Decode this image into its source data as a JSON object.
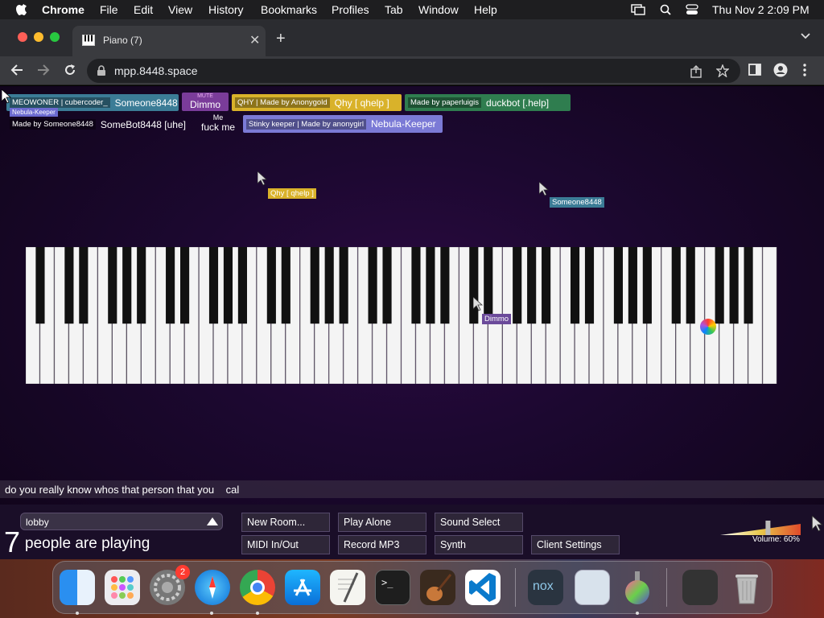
{
  "menubar": {
    "app": "Chrome",
    "items": [
      "File",
      "Edit",
      "View",
      "History",
      "Bookmarks",
      "Profiles",
      "Tab",
      "Window",
      "Help"
    ],
    "clock": "Thu Nov 2  2:09 PM"
  },
  "browser": {
    "tab_title": "Piano (7)",
    "url": "mpp.8448.space"
  },
  "participants": [
    {
      "sub": "MEOWONER | cubercoder_",
      "name": "Someone8448",
      "extra": "Nebula-Keeper",
      "color": "#3b7c96"
    },
    {
      "sub": "MUTE",
      "name": "Dimmo",
      "color": "#7a3c9a"
    },
    {
      "sub": "QHY | Made by Anonygold",
      "name": "Qhy [ qhelp ]",
      "color": "#d9b22a"
    },
    {
      "sub": "Made by paperluigis",
      "name": "duckbot [.help]",
      "color": "#2f7d4f"
    },
    {
      "sub": "Made by Someone8448",
      "name": "SomeBot8448 [uhe]",
      "color": "transparent"
    },
    {
      "sub": "Me",
      "name": "fuck me",
      "color": "transparent"
    },
    {
      "sub": "Stinky keeper | Made by anonygirl",
      "name": "Nebula-Keeper",
      "color": "#7b7ad6"
    }
  ],
  "cursors": [
    {
      "label": "Qhy [ qhelp ]",
      "color": "#d9b22a"
    },
    {
      "label": "Someone8448",
      "color": "#3b7c96"
    },
    {
      "label": "Dimmo",
      "color": "#6b4a9a"
    }
  ],
  "chat_input": "do you really know whos that person that you    cal",
  "controls": {
    "room": "lobby",
    "player_count": "7",
    "player_label": "people are playing",
    "buttons": [
      "New Room...",
      "Play Alone",
      "Sound Select",
      "MIDI In/Out",
      "Record MP3",
      "Synth",
      "Client Settings"
    ],
    "volume_label": "Volume: 60%",
    "volume_value": 0.6
  },
  "dock": {
    "settings_badge": "2",
    "apps": [
      "finder-icon",
      "launchpad-icon",
      "system-settings-icon",
      "safari-icon",
      "chrome-icon",
      "app-store-icon",
      "textedit-icon",
      "terminal-icon",
      "garageband-icon",
      "vscode-icon",
      "nox-icon",
      "preview-icon",
      "potion-icon",
      "stack-icon",
      "trash-icon"
    ],
    "nox_label": "nox"
  }
}
